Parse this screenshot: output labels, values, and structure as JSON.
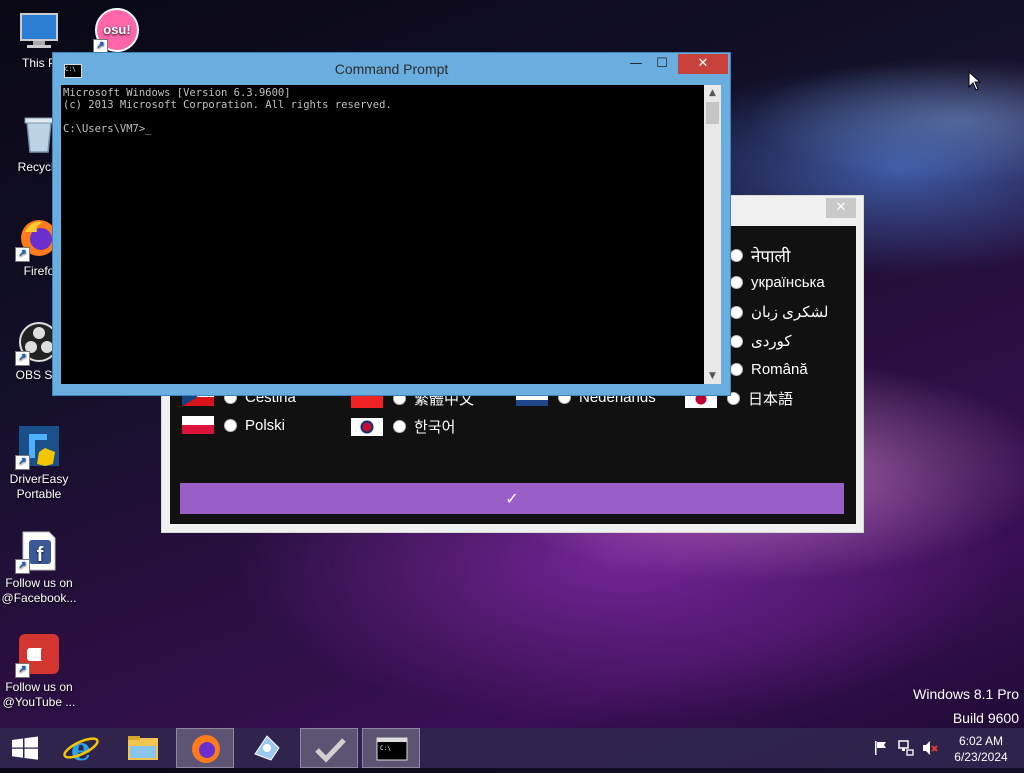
{
  "desktop": {
    "icons": [
      {
        "label": "This P"
      },
      {
        "label": "Recycle"
      },
      {
        "label": "Firefo"
      },
      {
        "label": "OBS Stu"
      },
      {
        "label": "DriverEasy Portable"
      },
      {
        "label": "Follow us on @Facebook..."
      },
      {
        "label": "Follow us on @YouTube ..."
      }
    ],
    "osu_icon_text": "osu!"
  },
  "cmd": {
    "title": "Command Prompt",
    "minimize": "—",
    "maximize": "☐",
    "close": "✕",
    "app_icon_text": "C:\\",
    "console_text": "Microsoft Windows [Version 6.3.9600]\n(c) 2013 Microsoft Corporation. All rights reserved.\n\nC:\\Users\\VM7>_"
  },
  "language_dialog": {
    "close": "✕",
    "confirm": "✓",
    "languages": {
      "nepali": "नेपाली",
      "ukrainian": "українська",
      "lashkari": "لشکری زبان",
      "kurdish": "کوردی",
      "romanian": "Română",
      "japanese": "日本語",
      "cestina": "Cestina",
      "traditional_chinese": "繁體中文",
      "dutch": "Nederlands",
      "polish": "Polski",
      "korean": "한국어"
    }
  },
  "taskbar": {
    "time": "6:02 AM",
    "date": "6/23/2024",
    "active_app": "command-prompt"
  },
  "watermark": {
    "line1": "Windows 8.1 Pro",
    "line2": "Build 9600"
  },
  "colors": {
    "cmd_frame": "#6aaee0",
    "close_red": "#c8423b",
    "confirm_purple": "#9a5fc6",
    "taskbar": "#30264e"
  }
}
